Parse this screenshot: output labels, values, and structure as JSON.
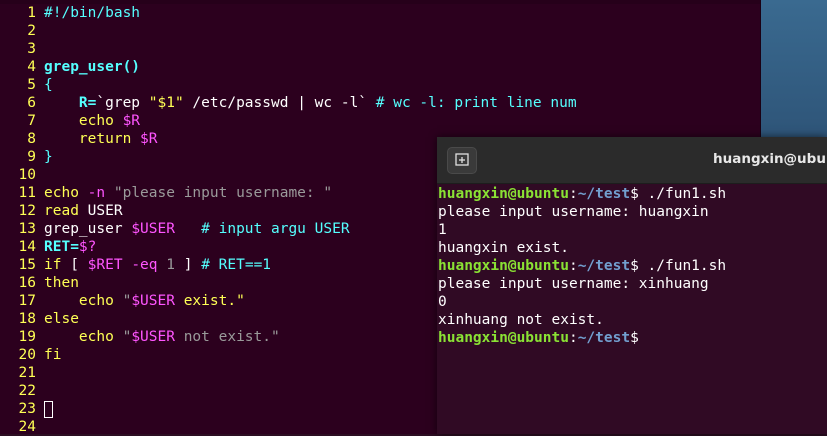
{
  "editor": {
    "lines": [
      {
        "n": "1",
        "segs": [
          {
            "t": "#!/bin/bash",
            "c": "cy"
          }
        ]
      },
      {
        "n": "2",
        "segs": []
      },
      {
        "n": "3",
        "segs": []
      },
      {
        "n": "4",
        "segs": [
          {
            "t": "grep_user()",
            "c": "fn"
          }
        ]
      },
      {
        "n": "5",
        "segs": [
          {
            "t": "{",
            "c": "cy"
          }
        ]
      },
      {
        "n": "6",
        "segs": [
          {
            "t": "    ",
            "c": ""
          },
          {
            "t": "R=",
            "c": "fn"
          },
          {
            "t": "`grep ",
            "c": ""
          },
          {
            "t": "\"$1\"",
            "c": "st"
          },
          {
            "t": " /etc/passwd | wc -l` ",
            "c": ""
          },
          {
            "t": "# wc -l: print line num",
            "c": "cy"
          }
        ]
      },
      {
        "n": "7",
        "segs": [
          {
            "t": "    echo ",
            "c": "st"
          },
          {
            "t": "$R",
            "c": "ma"
          }
        ]
      },
      {
        "n": "8",
        "segs": [
          {
            "t": "    return ",
            "c": "st"
          },
          {
            "t": "$R",
            "c": "ma"
          }
        ]
      },
      {
        "n": "9",
        "segs": [
          {
            "t": "}",
            "c": "cy"
          }
        ]
      },
      {
        "n": "10",
        "segs": []
      },
      {
        "n": "11",
        "segs": [
          {
            "t": "echo ",
            "c": "st"
          },
          {
            "t": "-n ",
            "c": "ma"
          },
          {
            "t": "\"please input username: \"",
            "c": "gr"
          }
        ]
      },
      {
        "n": "12",
        "segs": [
          {
            "t": "read ",
            "c": "st"
          },
          {
            "t": "USER",
            "c": ""
          }
        ]
      },
      {
        "n": "13",
        "segs": [
          {
            "t": "grep_user ",
            "c": ""
          },
          {
            "t": "$USER",
            "c": "ma"
          },
          {
            "t": "   # input argu USER",
            "c": "cy"
          }
        ]
      },
      {
        "n": "14",
        "segs": [
          {
            "t": "RET=",
            "c": "fn"
          },
          {
            "t": "$?",
            "c": "ma"
          }
        ]
      },
      {
        "n": "15",
        "segs": [
          {
            "t": "if ",
            "c": "st"
          },
          {
            "t": "[ ",
            "c": ""
          },
          {
            "t": "$RET -eq ",
            "c": "ma"
          },
          {
            "t": "1",
            "c": "gr"
          },
          {
            "t": " ] ",
            "c": ""
          },
          {
            "t": "# RET==1",
            "c": "cy"
          }
        ]
      },
      {
        "n": "16",
        "segs": [
          {
            "t": "then",
            "c": "st"
          }
        ]
      },
      {
        "n": "17",
        "segs": [
          {
            "t": "    echo ",
            "c": "st"
          },
          {
            "t": "\"",
            "c": "gr"
          },
          {
            "t": "$USER",
            "c": "ma"
          },
          {
            "t": " exist.\"",
            "c": "st"
          }
        ]
      },
      {
        "n": "18",
        "segs": [
          {
            "t": "else",
            "c": "st"
          }
        ]
      },
      {
        "n": "19",
        "segs": [
          {
            "t": "    echo ",
            "c": "st"
          },
          {
            "t": "\"",
            "c": "gr"
          },
          {
            "t": "$USER",
            "c": "ma"
          },
          {
            "t": " not exist.\"",
            "c": "gr"
          }
        ]
      },
      {
        "n": "20",
        "segs": [
          {
            "t": "fi",
            "c": "st"
          }
        ]
      },
      {
        "n": "21",
        "segs": []
      },
      {
        "n": "22",
        "segs": []
      },
      {
        "n": "23",
        "segs": [],
        "cursor": true
      },
      {
        "n": "24",
        "segs": []
      }
    ]
  },
  "terminal": {
    "title": "huangxin@ubuntu",
    "new_tab_icon": "new-tab-icon",
    "lines": [
      {
        "user": "huangxin@ubuntu",
        "sep": ":",
        "path": "~/test",
        "tail": "$ ./fun1.sh"
      },
      {
        "text": "please input username: huangxin"
      },
      {
        "text": "1"
      },
      {
        "text": "huangxin exist."
      },
      {
        "user": "huangxin@ubuntu",
        "sep": ":",
        "path": "~/test",
        "tail": "$ ./fun1.sh"
      },
      {
        "text": "please input username: xinhuang"
      },
      {
        "text": "0"
      },
      {
        "text": "xinhuang not exist."
      },
      {
        "user": "huangxin@ubuntu",
        "sep": ":",
        "path": "~/test",
        "tail": "$"
      }
    ]
  },
  "colors": {
    "editor_bg": "#2c001e",
    "terminal_bg": "#300a24",
    "line_number": "#ffff55",
    "prompt_user": "#8ae234",
    "prompt_path": "#729fcf"
  }
}
